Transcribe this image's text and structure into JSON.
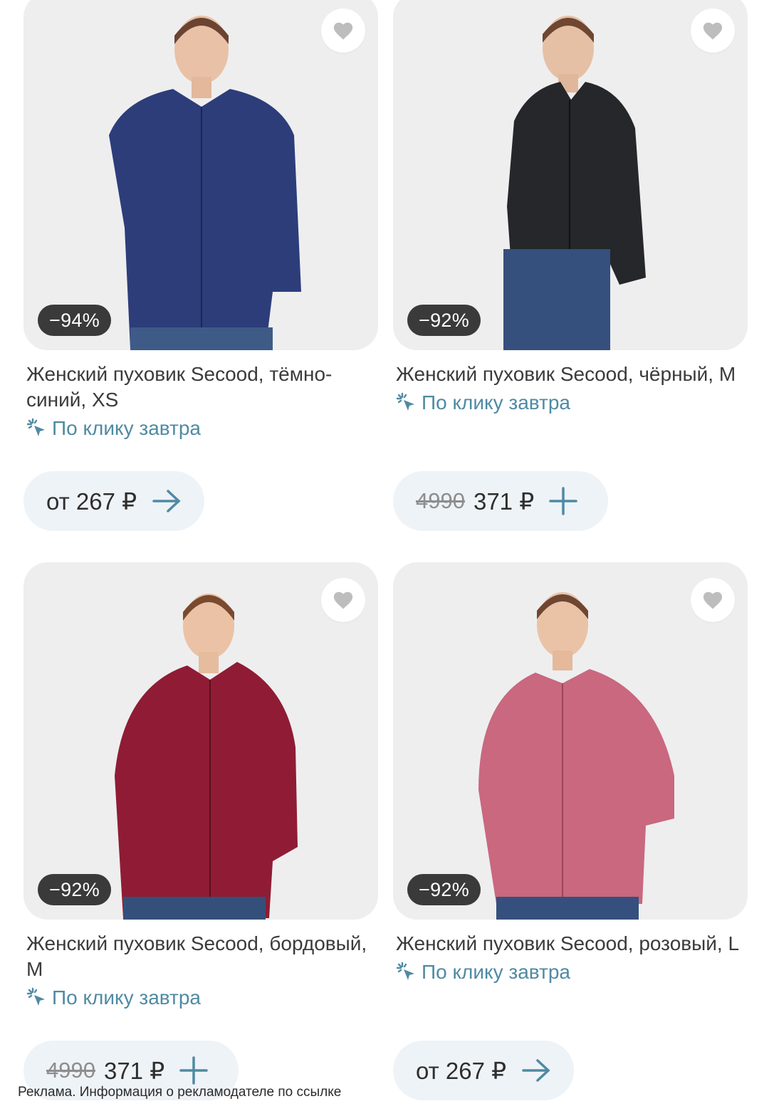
{
  "products": [
    {
      "title": "Женский пуховик Secood, тёмно-синий, XS",
      "discount": "−94%",
      "delivery": "По клику завтра",
      "price": "от 267 ₽",
      "old_price": "",
      "action_icon": "arrow-right-icon",
      "jacket_color": "#2c3d7a"
    },
    {
      "title": "Женский пуховик Secood, чёрный, M",
      "discount": "−92%",
      "delivery": "По клику завтра",
      "price": "371 ₽",
      "old_price": "4990",
      "action_icon": "plus-icon",
      "jacket_color": "#25272b"
    },
    {
      "title": "Женский пуховик Secood, бордовый, M",
      "discount": "−92%",
      "delivery": "По клику завтра",
      "price": "371 ₽",
      "old_price": "4990",
      "action_icon": "plus-icon",
      "jacket_color": "#8f1c34"
    },
    {
      "title": "Женский пуховик Secood, розовый, L",
      "discount": "−92%",
      "delivery": "По клику завтра",
      "price": "от 267 ₽",
      "old_price": "",
      "action_icon": "arrow-right-icon",
      "jacket_color": "#c9687f"
    }
  ],
  "ad_note": "Реклама. Информация о рекламодателе по ссылке",
  "colors": {
    "accent": "#4f8aa3",
    "badge": "#3a3a3a",
    "button_bg": "#eef3f7"
  }
}
